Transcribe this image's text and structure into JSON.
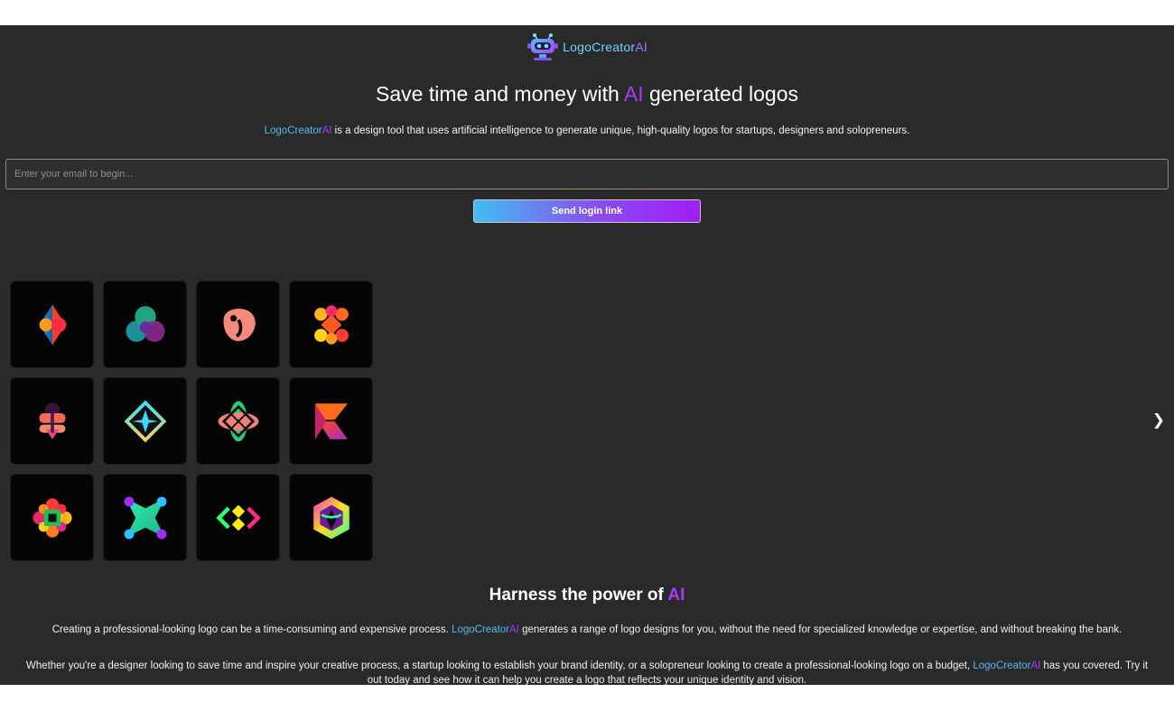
{
  "brand": {
    "main": "LogoCreator",
    "ai": "AI"
  },
  "hero": {
    "headline_before": "Save time and money with ",
    "headline_ai": "AI",
    "headline_after": " generated logos",
    "sub_brand": "LogoCreator",
    "sub_brand_ai": "AI",
    "sub_text": " is a design tool that uses artificial intelligence to generate unique, high-quality logos for startups, designers and solopreneurs."
  },
  "form": {
    "email_placeholder": "Enter your email to begin...",
    "send_label": "Send login link"
  },
  "carousel": {
    "prev": "❮",
    "next": "❯",
    "logos": [
      "split-drop-logo-icon",
      "triple-circle-logo-icon",
      "pebble-logo-icon",
      "orange-cluster-logo-icon",
      "coral-shield-logo-icon",
      "cyan-diamond-logo-icon",
      "green-lattice-logo-icon",
      "orange-k-logo-icon",
      "flower-logo-icon",
      "green-star-logo-icon",
      "neon-chevrons-logo-icon",
      "rainbow-knot-logo-icon"
    ]
  },
  "section": {
    "title_before": "Harness the power of ",
    "title_ai": "AI",
    "p1_before": "Creating a professional-looking logo can be a time-consuming and expensive process. ",
    "p1_brand": "LogoCreator",
    "p1_brand_ai": "AI",
    "p1_after": " generates a range of logo designs for you, without the need for specialized knowledge or expertise, and without breaking the bank.",
    "p2_before": "Whether you're a designer looking to save time and inspire your creative process, a startup looking to establish your brand identity, or a solopreneur looking to create a professional-looking logo on a budget, ",
    "p2_brand": "LogoCreator",
    "p2_brand_ai": "AI",
    "p2_after": " has you covered. Try it out today and see how it can help you create a logo that reflects your unique identity and vision."
  },
  "colors": {
    "background": "#2a2a2a",
    "accent_purple": "#a73cff",
    "accent_blue": "#55b9f0"
  }
}
